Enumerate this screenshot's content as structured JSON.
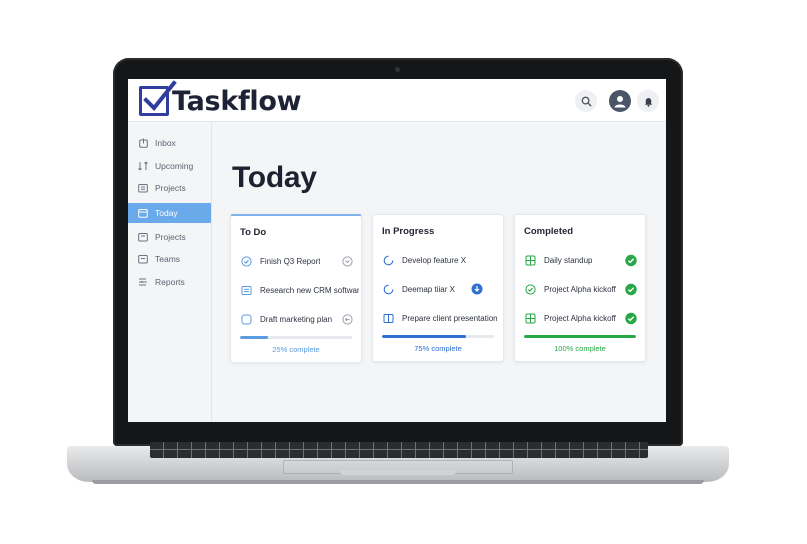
{
  "app": {
    "name": "Taskflow"
  },
  "header": {
    "icons": [
      "search-icon",
      "avatar",
      "bell-icon"
    ]
  },
  "sidebar": {
    "items": [
      {
        "label": "Inbox",
        "icon": "inbox-icon"
      },
      {
        "label": "Upcoming",
        "icon": "upcoming-icon"
      },
      {
        "label": "Projects",
        "icon": "folder-icon"
      },
      {
        "label": "Today",
        "icon": "calendar-icon",
        "active": true
      },
      {
        "label": "Projects",
        "icon": "folder-icon"
      },
      {
        "label": "Teams",
        "icon": "team-icon"
      },
      {
        "label": "Reports",
        "icon": "reports-icon"
      }
    ],
    "active_color": "#6aa9ea"
  },
  "main": {
    "title": "Today",
    "columns": [
      {
        "title": "To Do",
        "tasks": [
          "Finish Q3 Report",
          "Research new CRM software",
          "Draft marketing plan"
        ],
        "progress": 25,
        "progress_label": "25% complete",
        "accent": "#5b9be0"
      },
      {
        "title": "In Progress",
        "tasks": [
          "Develop feature X",
          "Deemap tiiar X",
          "Prepare client presentation"
        ],
        "progress": 75,
        "progress_label": "75% complete",
        "accent": "#2f6fd0"
      },
      {
        "title": "Completed",
        "tasks": [
          "Daily standup",
          "Project Alpha kickoff",
          "Project Alpha kickoff"
        ],
        "progress": 100,
        "progress_label": "100% complete",
        "accent": "#27a745"
      }
    ]
  }
}
